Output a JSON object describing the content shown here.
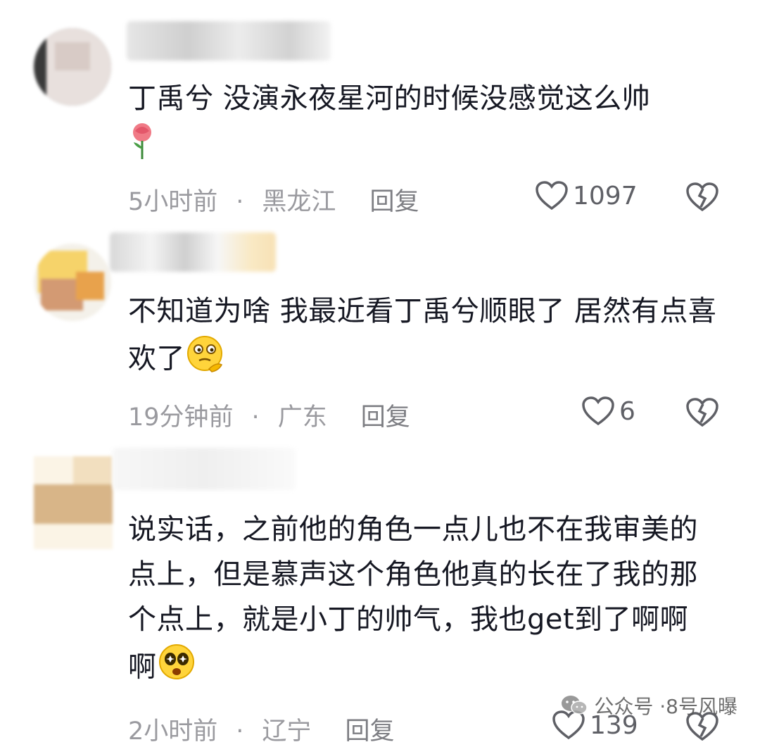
{
  "comments": [
    {
      "text": "丁禹兮 没演永夜星河的时候没感觉这么帅",
      "emoji": "rose-emoji",
      "time": "5小时前",
      "location": "黑龙江",
      "reply": "回复",
      "likes": "1097"
    },
    {
      "text": "不知道为啥 我最近看丁禹兮顺眼了 居然有点喜欢了",
      "emoji": "thinking-face-emoji",
      "time": "19分钟前",
      "location": "广东",
      "reply": "回复",
      "likes": "6"
    },
    {
      "text": "说实话，之前他的角色一点儿也不在我审美的点上，但是慕声这个角色他真的长在了我的那个点上，就是小丁的帅气，我也get到了啊啊啊",
      "emoji": "starry-eyes-emoji",
      "time": "2小时前",
      "location": "辽宁",
      "reply": "回复",
      "likes": "139"
    }
  ],
  "separator": "·",
  "watermark": {
    "prefix": "公众号 · ",
    "name": "8号风曝"
  },
  "colors": {
    "text": "#161823",
    "meta": "#9a9a9f",
    "icon": "#5f6066"
  }
}
